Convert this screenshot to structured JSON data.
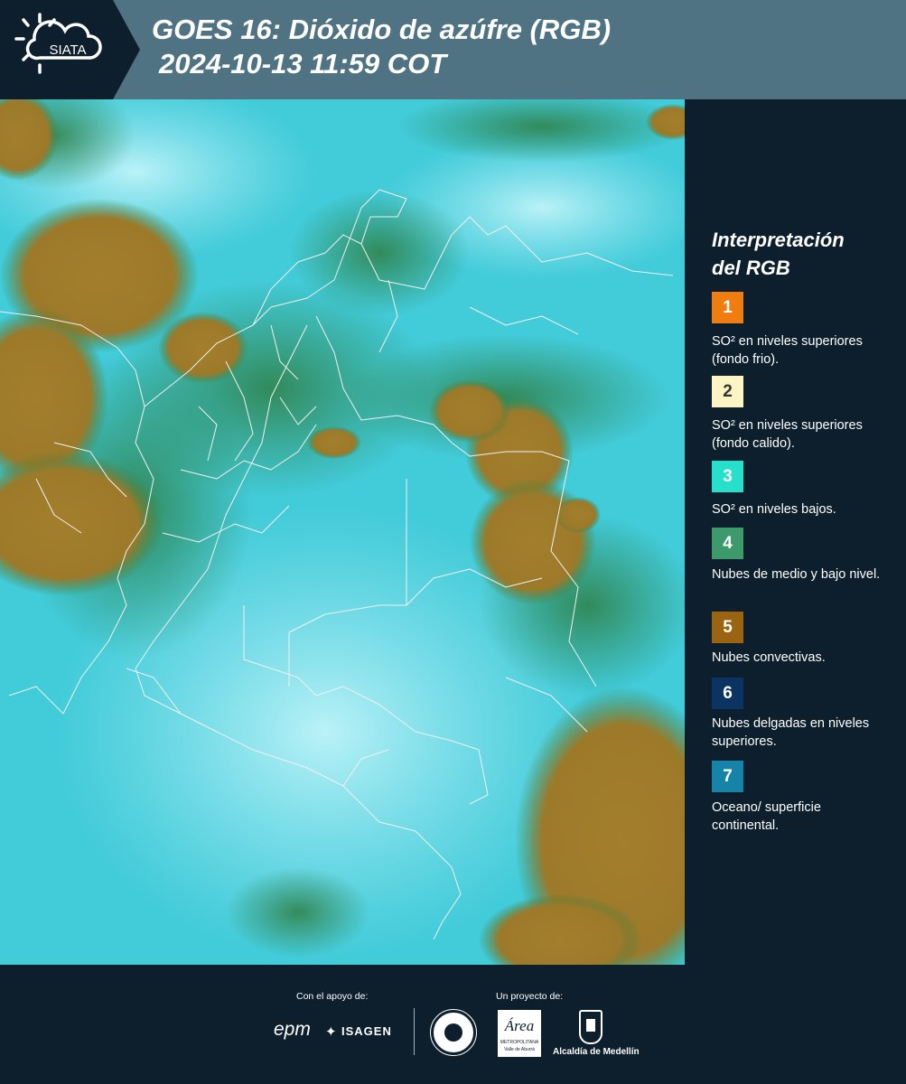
{
  "header": {
    "logo_text": "SIATA",
    "title_line1": "GOES 16: Dióxido de azúfre (RGB)",
    "title_line2": "2024-10-13 11:59 COT"
  },
  "legend": {
    "title_line1": "Interpretación",
    "title_line2": "del RGB",
    "items": [
      {
        "number": "1",
        "label": "SO² en niveles superiores (fondo frio).",
        "color": "#f07d0f"
      },
      {
        "number": "2",
        "label": "SO² en niveles superiores (fondo calido).",
        "color": "#fdf4c4"
      },
      {
        "number": "3",
        "label": "SO² en niveles bajos.",
        "color": "#27e0cc"
      },
      {
        "number": "4",
        "label": "Nubes de medio y bajo nivel.",
        "color": "#3d9a6a"
      },
      {
        "number": "5",
        "label": "Nubes convectivas.",
        "color": "#9a6410"
      },
      {
        "number": "6",
        "label": "Nubes delgadas en niveles superiores.",
        "color": "#0b3463"
      },
      {
        "number": "7",
        "label": "Oceano/ superficie continental.",
        "color": "#1584a8"
      }
    ]
  },
  "footer": {
    "support_caption": "Con el apoyo de:",
    "project_caption": "Un proyecto de:",
    "sponsor_epm": "epm",
    "sponsor_isagen": "ISAGEN",
    "area_name": "Área",
    "area_subtitle": "METROPOLITANA",
    "area_subtitle2": "Valle de Aburrá",
    "alcaldia": "Alcaldía de Medellín"
  },
  "map": {
    "ocean_color": "#3cc8d8",
    "cloud_color": "#a08030",
    "low_cloud_color": "#3d8f4a",
    "border_color": "#f2f2f2"
  }
}
